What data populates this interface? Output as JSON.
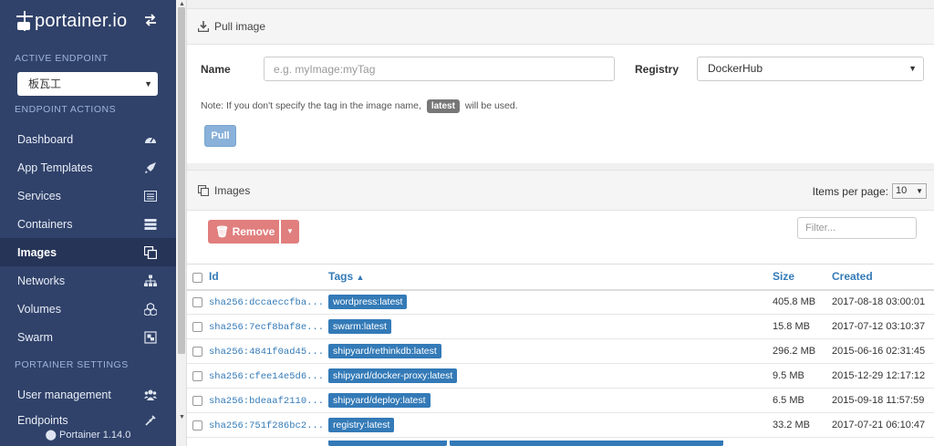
{
  "sidebar": {
    "brand": "portainer.io",
    "active_endpoint_title": "ACTIVE ENDPOINT",
    "endpoint_value": "板瓦工",
    "endpoint_actions_title": "ENDPOINT ACTIONS",
    "items": [
      {
        "label": "Dashboard",
        "icon": "tachometer-icon"
      },
      {
        "label": "App Templates",
        "icon": "rocket-icon"
      },
      {
        "label": "Services",
        "icon": "list-alt-icon"
      },
      {
        "label": "Containers",
        "icon": "server-icon"
      },
      {
        "label": "Images",
        "icon": "clone-icon",
        "active": true
      },
      {
        "label": "Networks",
        "icon": "sitemap-icon"
      },
      {
        "label": "Volumes",
        "icon": "cubes-icon"
      },
      {
        "label": "Swarm",
        "icon": "object-group-icon"
      }
    ],
    "settings_title": "PORTAINER SETTINGS",
    "settings_items": [
      {
        "label": "User management",
        "icon": "users-icon"
      },
      {
        "label": "Endpoints",
        "icon": "plug-icon"
      }
    ],
    "footer": "Portainer 1.14.0"
  },
  "pull": {
    "title": "Pull image",
    "name_label": "Name",
    "name_placeholder": "e.g. myImage:myTag",
    "registry_label": "Registry",
    "registry_value": "DockerHub",
    "note_prefix": "Note: If you don't specify the tag in the image name,",
    "note_badge": "latest",
    "note_suffix": "will be used.",
    "button": "Pull"
  },
  "images": {
    "title": "Images",
    "items_per_page_label": "Items per page:",
    "items_per_page_value": "10",
    "remove_label": "Remove",
    "filter_placeholder": "Filter...",
    "columns": {
      "id": "Id",
      "tags": "Tags",
      "size": "Size",
      "created": "Created"
    },
    "rows": [
      {
        "id": "sha256:dccaeccfba...",
        "tag": "wordpress:latest",
        "size": "405.8 MB",
        "created": "2017-08-18 03:00:01"
      },
      {
        "id": "sha256:7ecf8baf8e...",
        "tag": "swarm:latest",
        "size": "15.8 MB",
        "created": "2017-07-12 03:10:37"
      },
      {
        "id": "sha256:4841f0ad45...",
        "tag": "shipyard/rethinkdb:latest",
        "size": "296.2 MB",
        "created": "2015-06-16 02:31:45"
      },
      {
        "id": "sha256:cfee14e5d6...",
        "tag": "shipyard/docker-proxy:latest",
        "size": "9.5 MB",
        "created": "2015-12-29 12:17:12"
      },
      {
        "id": "sha256:bdeaaf2110...",
        "tag": "shipyard/deploy:latest",
        "size": "6.5 MB",
        "created": "2015-09-18 11:57:59"
      },
      {
        "id": "sha256:751f286bc2...",
        "tag": "registry:latest",
        "size": "33.2 MB",
        "created": "2017-07-21 06:10:47"
      }
    ]
  },
  "colors": {
    "sidebar": "#30426a",
    "accent": "#337ab7",
    "danger": "#e07f7e"
  }
}
